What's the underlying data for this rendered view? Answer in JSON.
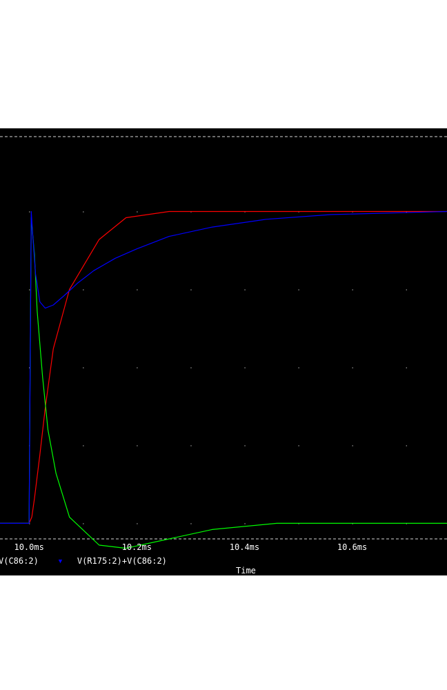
{
  "chart_data": {
    "type": "line",
    "xlabel": "Time",
    "ylabel": "",
    "x_unit": "ms",
    "xlim": [
      9.946,
      10.776
    ],
    "ylim": [
      -0.05,
      1.24
    ],
    "x_ticks": [
      {
        "value": 10.0,
        "label": "10.0ms"
      },
      {
        "value": 10.2,
        "label": "10.2ms"
      },
      {
        "value": 10.4,
        "label": "10.4ms"
      },
      {
        "value": 10.6,
        "label": "10.6ms"
      }
    ],
    "grid": "dotted",
    "legend_position": "bottom-left",
    "series": [
      {
        "name": "V(C86:2)",
        "color": "#ff0000",
        "legend_shown": false,
        "x": [
          9.946,
          10.0,
          10.005,
          10.01,
          10.02,
          10.03,
          10.045,
          10.075,
          10.13,
          10.18,
          10.26,
          10.776
        ],
        "y": [
          0.0,
          0.0,
          0.02,
          0.08,
          0.22,
          0.37,
          0.56,
          0.75,
          0.91,
          0.98,
          1.0,
          1.0
        ]
      },
      {
        "name": "",
        "color": "#00ff00",
        "legend_shown": false,
        "x": [
          9.946,
          10.0,
          10.002,
          10.004,
          10.01,
          10.015,
          10.025,
          10.035,
          10.05,
          10.075,
          10.13,
          10.18,
          10.26,
          10.34,
          10.46,
          10.6,
          10.776
        ],
        "y": [
          0.0,
          0.0,
          0.5,
          0.98,
          0.86,
          0.68,
          0.47,
          0.3,
          0.16,
          0.02,
          -0.07,
          -0.08,
          -0.05,
          -0.02,
          0.0,
          0.0,
          0.0
        ]
      },
      {
        "name": "V(R175:2)+V(C86:2)",
        "color": "#0000ff",
        "legend_shown": true,
        "x": [
          9.946,
          10.0,
          10.002,
          10.004,
          10.007,
          10.012,
          10.02,
          10.03,
          10.045,
          10.065,
          10.09,
          10.12,
          10.16,
          10.2,
          10.26,
          10.34,
          10.44,
          10.56,
          10.776
        ],
        "y": [
          0.0,
          0.0,
          0.5,
          1.0,
          0.92,
          0.8,
          0.71,
          0.69,
          0.7,
          0.73,
          0.77,
          0.81,
          0.85,
          0.88,
          0.92,
          0.95,
          0.975,
          0.99,
          1.0
        ]
      }
    ]
  },
  "legend": {
    "items": [
      {
        "label": "V(C86:2)",
        "marker": "",
        "color": "#ff0000"
      },
      {
        "label": "V(R175:2)+V(C86:2)",
        "marker": "▼",
        "color": "#0000ff"
      }
    ]
  },
  "colors": {
    "background": "#000000",
    "grid": "#ffffff",
    "frame": "#ffffff"
  }
}
